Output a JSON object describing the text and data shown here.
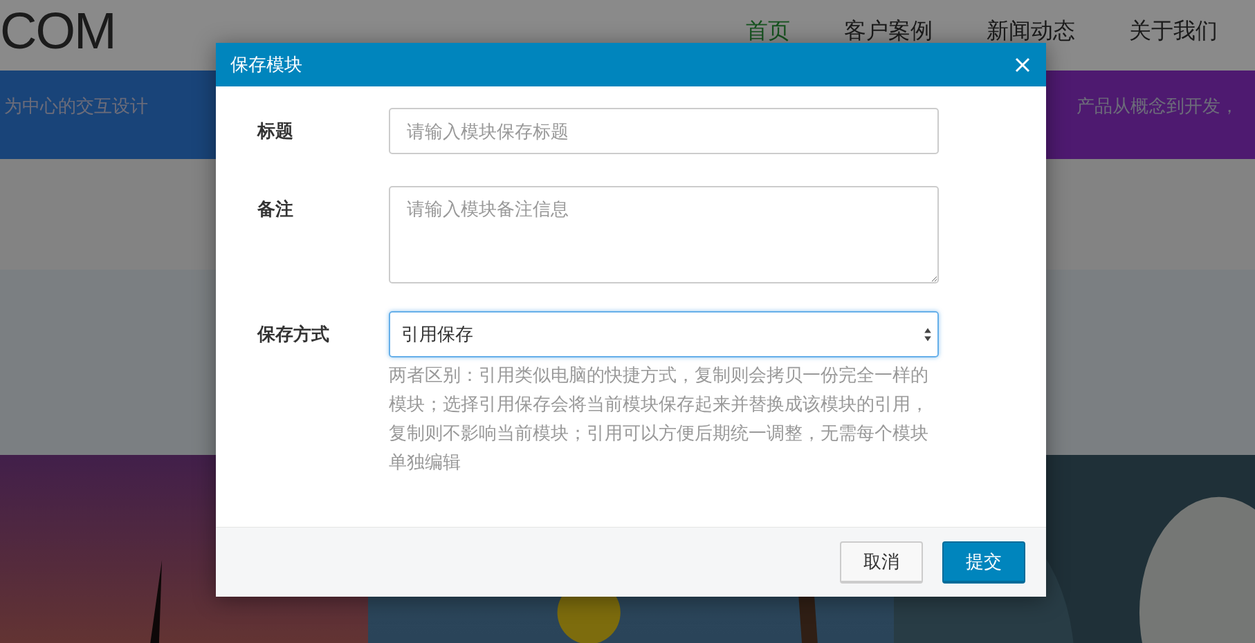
{
  "page": {
    "logo": "COM",
    "nav": [
      {
        "label": "首页",
        "selected": true
      },
      {
        "label": "客户案例",
        "selected": false
      },
      {
        "label": "新闻动态",
        "selected": false
      },
      {
        "label": "关于我们",
        "selected": false
      }
    ],
    "banners": [
      {
        "text": "为中心的交互设计"
      },
      {
        "text": "产品从概念到开发，"
      }
    ]
  },
  "dialog": {
    "title": "保存模块",
    "fields": [
      {
        "kind": "text",
        "label": "标题",
        "placeholder": "请输入模块保存标题"
      },
      {
        "kind": "textarea",
        "label": "备注",
        "placeholder": "请输入模块备注信息"
      },
      {
        "kind": "select",
        "label": "保存方式",
        "value": "引用保存",
        "focused": true,
        "help": "两者区别：引用类似电脑的快捷方式，复制则会拷贝一份完全一样的模块；选择引用保存会将当前模块保存起来并替换成该模块的引用，复制则不影响当前模块；引用可以方便后期统一调整，无需每个模块单独编辑"
      }
    ],
    "buttons": [
      {
        "label": "取消",
        "kind": "default"
      },
      {
        "label": "提交",
        "kind": "primary"
      }
    ]
  }
}
